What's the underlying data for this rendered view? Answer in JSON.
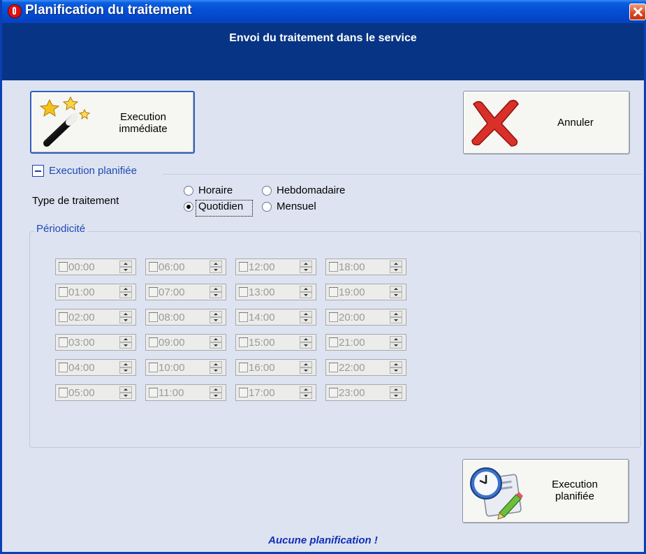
{
  "window": {
    "title": "Planification du traitement"
  },
  "header": {
    "text": "Envoi du traitement dans le service"
  },
  "buttons": {
    "immediate": {
      "line1": "Execution",
      "line2": "immédiate"
    },
    "cancel": {
      "label": "Annuler"
    },
    "planned": {
      "line1": "Execution",
      "line2": "planifiée"
    }
  },
  "section": {
    "label": "Execution planifiée",
    "expanded": true
  },
  "type": {
    "label": "Type de traitement",
    "options": [
      {
        "label": "Horaire",
        "checked": false
      },
      {
        "label": "Hebdomadaire",
        "checked": false
      },
      {
        "label": "Quotidien",
        "checked": true
      },
      {
        "label": "Mensuel",
        "checked": false
      }
    ]
  },
  "periodicity": {
    "label": "Périodicité",
    "times": [
      "00:00",
      "01:00",
      "02:00",
      "03:00",
      "04:00",
      "05:00",
      "06:00",
      "07:00",
      "08:00",
      "09:00",
      "10:00",
      "11:00",
      "12:00",
      "13:00",
      "14:00",
      "15:00",
      "16:00",
      "17:00",
      "18:00",
      "19:00",
      "20:00",
      "21:00",
      "22:00",
      "23:00"
    ]
  },
  "status": "Aucune planification !",
  "icons": {
    "immediate": "magic-wand-icon",
    "cancel": "red-x-icon",
    "planned": "clock-calendar-icon",
    "app": "app-logo-icon",
    "close": "close-icon"
  }
}
